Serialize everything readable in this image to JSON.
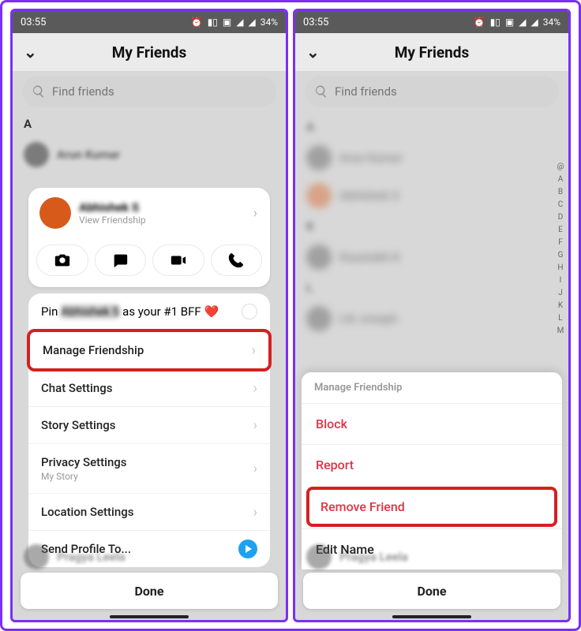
{
  "status": {
    "time": "03:55",
    "battery": "34%"
  },
  "header": {
    "title": "My Friends"
  },
  "search": {
    "placeholder": "Find friends"
  },
  "s1": {
    "section": "A",
    "friend1": "Arun Kumar",
    "profile_name": "Abhishek S",
    "view_friendship": "View Friendship",
    "pin_prefix": "Pin ",
    "pin_name": "Abhishek S",
    "pin_suffix": " as your #1 BFF ",
    "pin_heart": "❤️",
    "manage": "Manage Friendship",
    "chat": "Chat Settings",
    "story": "Story Settings",
    "privacy": "Privacy Settings",
    "privacy_sub": "My Story",
    "location": "Location Settings",
    "send_to": "Send Profile To...",
    "under_name": "Pragya Leela",
    "done": "Done"
  },
  "s2": {
    "sectionA": "A",
    "f1": "Arun Kumar",
    "f2": "Abhishek S",
    "sectionK": "K",
    "f3": "Kaustubh K",
    "sectionL": "L",
    "f4": "Lib Joseph",
    "popup_title": "Manage Friendship",
    "block": "Block",
    "report": "Report",
    "remove": "Remove Friend",
    "edit": "Edit Name",
    "under_name": "Pragya Leela",
    "done": "Done",
    "alpha": "@\nA\nB\nC\nD\nE\nF\nG\nH\nI\nJ\nK\nL\nM"
  }
}
